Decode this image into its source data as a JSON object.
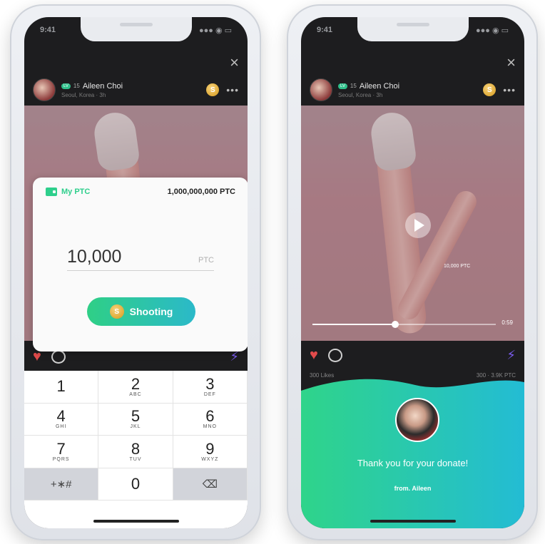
{
  "left_screen": {
    "status": {
      "time": "9:41",
      "icons": "●●● ◉ ▭"
    },
    "close_icon": "×",
    "user": {
      "level_badge": "LV",
      "level": "15",
      "name": "Aileen Choi",
      "location": "Seoul, Korea · 3h"
    },
    "coin_symbol": "S",
    "more_icon": "•••",
    "modal": {
      "wallet_label": "My PTC",
      "balance": "1,000,000,000 PTC",
      "amount": "10,000",
      "unit": "PTC",
      "button_label": "Shooting"
    },
    "actions": {
      "heart_icon": "♥",
      "bolt_icon": "⚡"
    },
    "keypad": [
      {
        "num": "1",
        "sub": ""
      },
      {
        "num": "2",
        "sub": "ABC"
      },
      {
        "num": "3",
        "sub": "DEF"
      },
      {
        "num": "4",
        "sub": "GHI"
      },
      {
        "num": "5",
        "sub": "JKL"
      },
      {
        "num": "6",
        "sub": "MNO"
      },
      {
        "num": "7",
        "sub": "PQRS"
      },
      {
        "num": "8",
        "sub": "TUV"
      },
      {
        "num": "9",
        "sub": "WXYZ"
      },
      {
        "num": "+∗#",
        "sub": ""
      },
      {
        "num": "0",
        "sub": ""
      },
      {
        "num": "⌫",
        "sub": ""
      }
    ]
  },
  "right_screen": {
    "status": {
      "time": "9:41",
      "icons": "●●● ◉ ▭"
    },
    "close_icon": "×",
    "user": {
      "level_badge": "LV",
      "level": "15",
      "name": "Aileen Choi",
      "location": "Seoul, Korea · 3h"
    },
    "coin_symbol": "S",
    "more_icon": "•••",
    "video": {
      "overlay_text": "10,000 PTC",
      "time": "0:59",
      "progress": 0.45
    },
    "actions": {
      "heart_icon": "♥",
      "bolt_icon": "⚡"
    },
    "stats": {
      "likes": "300 Likes",
      "right": "300 · 3.9K PTC"
    },
    "donation": {
      "message": "Thank you for your donate!",
      "from": "from.  Aileen"
    }
  },
  "colors": {
    "accent_green": "#2ecf8c",
    "accent_teal": "#2bb9c9",
    "heart": "#e24b4b",
    "bolt": "#7b5cf0"
  }
}
